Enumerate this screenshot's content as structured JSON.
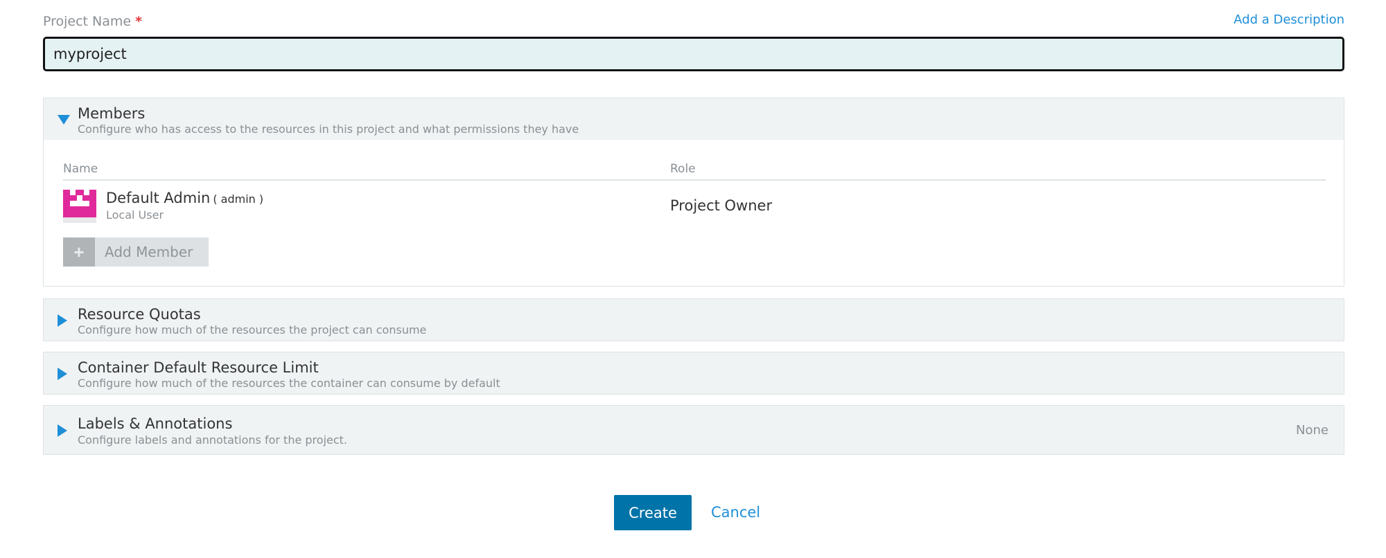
{
  "form": {
    "project_name_label": "Project Name",
    "required_marker": "*",
    "add_description_link": "Add a Description",
    "project_name_value": "myproject"
  },
  "sections": {
    "members": {
      "title": "Members",
      "subtitle": "Configure who has access to the resources in this project and what permissions they have",
      "expanded": true,
      "columns": {
        "name": "Name",
        "role": "Role"
      },
      "rows": [
        {
          "display_name": "Default Admin",
          "login": "( admin )",
          "type": "Local User",
          "role": "Project Owner",
          "avatar_color": "#e0299b"
        }
      ],
      "add_member_label": "Add Member"
    },
    "resource_quotas": {
      "title": "Resource Quotas",
      "subtitle": "Configure how much of the resources the project can consume",
      "expanded": false
    },
    "container_limit": {
      "title": "Container Default Resource Limit",
      "subtitle": "Configure how much of the resources the container can consume by default",
      "expanded": false
    },
    "labels": {
      "title": "Labels & Annotations",
      "subtitle": "Configure labels and annotations for the project.",
      "value": "None",
      "expanded": false
    }
  },
  "actions": {
    "create_label": "Create",
    "cancel_label": "Cancel"
  },
  "colors": {
    "accent": "#1f8fd8",
    "primary_button": "#0073a8",
    "section_bg": "#f0f3f4",
    "input_bg": "#e5f2f3"
  }
}
